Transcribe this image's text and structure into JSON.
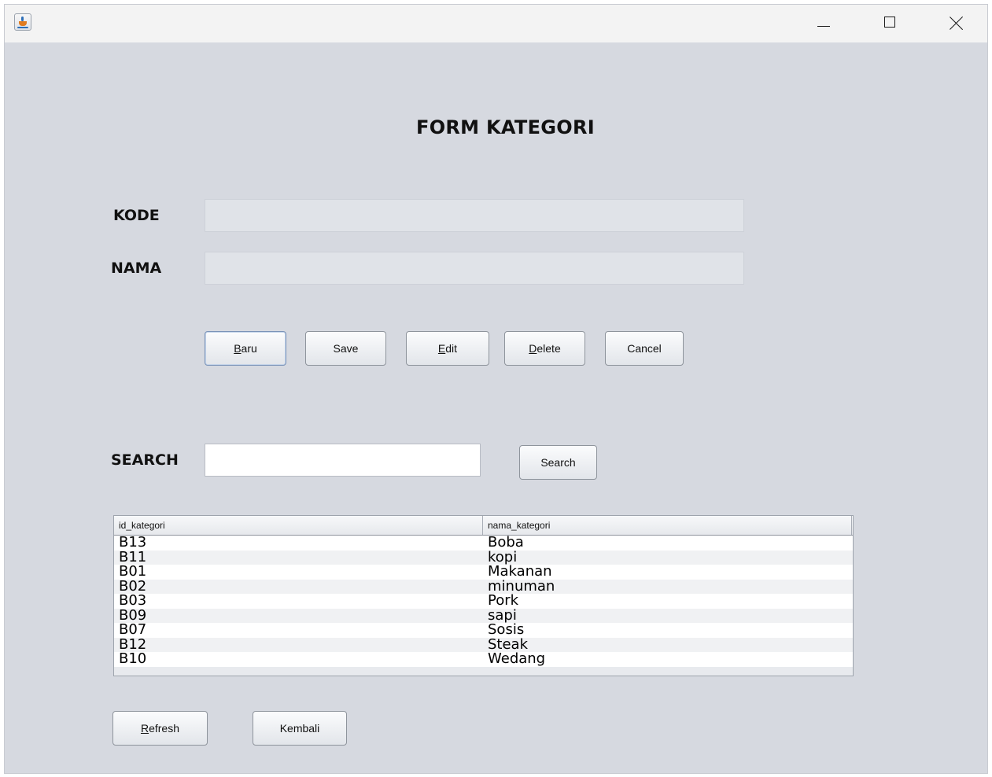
{
  "window": {
    "controls": {
      "minimize": "minimize-icon",
      "maximize": "maximize-icon",
      "close": "close-icon"
    },
    "app_icon": "java-cup-icon"
  },
  "form": {
    "title": "FORM KATEGORI",
    "kode_label": "KODE",
    "kode_value": "",
    "nama_label": "NAMA",
    "nama_value": ""
  },
  "buttons": {
    "baru": {
      "mnemonic": "B",
      "rest": "aru"
    },
    "save": "Save",
    "edit": {
      "mnemonic": "E",
      "rest": "dit"
    },
    "delete": {
      "mnemonic": "D",
      "rest": "elete"
    },
    "cancel": "Cancel",
    "refresh": {
      "mnemonic": "R",
      "rest": "efresh"
    },
    "kembali": "Kembali"
  },
  "search": {
    "label": "SEARCH",
    "value": "",
    "button": "Search"
  },
  "table": {
    "columns": [
      "id_kategori",
      "nama_kategori"
    ],
    "rows": [
      [
        "B13",
        "Boba"
      ],
      [
        "B11",
        "kopi"
      ],
      [
        "B01",
        "Makanan"
      ],
      [
        "B02",
        "minuman"
      ],
      [
        "B03",
        "Pork"
      ],
      [
        "B09",
        "sapi"
      ],
      [
        "B07",
        "Sosis"
      ],
      [
        "B12",
        "Steak"
      ],
      [
        "B10",
        "Wedang"
      ]
    ]
  }
}
